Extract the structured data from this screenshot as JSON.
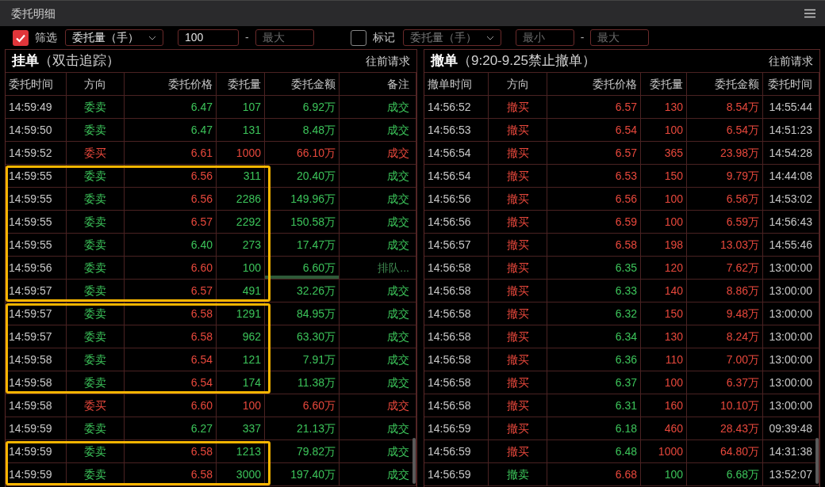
{
  "window": {
    "title": "委托明细"
  },
  "filter": {
    "checked": true,
    "label": "筛选",
    "select": "委托量（手）",
    "min_value": "100",
    "separator": "-",
    "max_placeholder": "最大"
  },
  "mark": {
    "checked": false,
    "label": "标记",
    "select": "委托量（手）",
    "min_placeholder": "最小",
    "separator": "-",
    "max_placeholder": "最大"
  },
  "orders": {
    "title": "挂单",
    "subtitle": "（双击追踪）",
    "action": "往前请求",
    "columns": [
      "委托时间",
      "方向",
      "委托价格",
      "委托量",
      "委托金额",
      "备注"
    ],
    "row_groups": [
      {
        "highlighted": false,
        "rows": [
          {
            "time": "14:59:49",
            "kind": "sell",
            "direction": "委卖",
            "price": "6.47",
            "price_up": false,
            "qty": "107",
            "amount": "6.92万",
            "remark": "成交",
            "queued": false
          },
          {
            "time": "14:59:50",
            "kind": "sell",
            "direction": "委卖",
            "price": "6.47",
            "price_up": false,
            "qty": "131",
            "amount": "8.48万",
            "remark": "成交",
            "queued": false
          },
          {
            "time": "14:59:52",
            "kind": "buy",
            "direction": "委买",
            "price": "6.61",
            "price_up": true,
            "qty": "1000",
            "amount": "66.10万",
            "remark": "成交",
            "queued": false
          }
        ]
      },
      {
        "highlighted": true,
        "rows": [
          {
            "time": "14:59:55",
            "kind": "sell",
            "direction": "委卖",
            "price": "6.56",
            "price_up": true,
            "qty": "311",
            "amount": "20.40万",
            "remark": "成交",
            "queued": false
          },
          {
            "time": "14:59:55",
            "kind": "sell",
            "direction": "委卖",
            "price": "6.56",
            "price_up": true,
            "qty": "2286",
            "amount": "149.96万",
            "remark": "成交",
            "queued": false
          },
          {
            "time": "14:59:55",
            "kind": "sell",
            "direction": "委卖",
            "price": "6.57",
            "price_up": true,
            "qty": "2292",
            "amount": "150.58万",
            "remark": "成交",
            "queued": false
          },
          {
            "time": "14:59:55",
            "kind": "sell",
            "direction": "委卖",
            "price": "6.40",
            "price_up": false,
            "qty": "273",
            "amount": "17.47万",
            "remark": "成交",
            "queued": false
          },
          {
            "time": "14:59:56",
            "kind": "sell",
            "direction": "委卖",
            "price": "6.60",
            "price_up": true,
            "qty": "100",
            "amount": "6.60万",
            "remark": "排队...",
            "queued": true
          },
          {
            "time": "14:59:57",
            "kind": "sell",
            "direction": "委卖",
            "price": "6.57",
            "price_up": true,
            "qty": "491",
            "amount": "32.26万",
            "remark": "成交",
            "queued": false
          }
        ]
      },
      {
        "highlighted": true,
        "rows": [
          {
            "time": "14:59:57",
            "kind": "sell",
            "direction": "委卖",
            "price": "6.58",
            "price_up": true,
            "qty": "1291",
            "amount": "84.95万",
            "remark": "成交",
            "queued": false
          },
          {
            "time": "14:59:57",
            "kind": "sell",
            "direction": "委卖",
            "price": "6.58",
            "price_up": true,
            "qty": "962",
            "amount": "63.30万",
            "remark": "成交",
            "queued": false
          },
          {
            "time": "14:59:58",
            "kind": "sell",
            "direction": "委卖",
            "price": "6.54",
            "price_up": true,
            "qty": "121",
            "amount": "7.91万",
            "remark": "成交",
            "queued": false
          },
          {
            "time": "14:59:58",
            "kind": "sell",
            "direction": "委卖",
            "price": "6.54",
            "price_up": true,
            "qty": "174",
            "amount": "11.38万",
            "remark": "成交",
            "queued": false
          }
        ]
      },
      {
        "highlighted": false,
        "rows": [
          {
            "time": "14:59:58",
            "kind": "buy",
            "direction": "委买",
            "price": "6.60",
            "price_up": true,
            "qty": "100",
            "amount": "6.60万",
            "remark": "成交",
            "queued": false
          },
          {
            "time": "14:59:59",
            "kind": "sell",
            "direction": "委卖",
            "price": "6.27",
            "price_up": false,
            "qty": "337",
            "amount": "21.13万",
            "remark": "成交",
            "queued": false
          }
        ]
      },
      {
        "highlighted": true,
        "rows": [
          {
            "time": "14:59:59",
            "kind": "sell",
            "direction": "委卖",
            "price": "6.58",
            "price_up": true,
            "qty": "1213",
            "amount": "79.82万",
            "remark": "成交",
            "queued": false
          },
          {
            "time": "14:59:59",
            "kind": "sell",
            "direction": "委卖",
            "price": "6.58",
            "price_up": true,
            "qty": "3000",
            "amount": "197.40万",
            "remark": "成交",
            "queued": false
          }
        ]
      }
    ]
  },
  "cancels": {
    "title": "撤单",
    "subtitle": "（9:20-9.25禁止撤单）",
    "action": "往前请求",
    "columns": [
      "撤单时间",
      "方向",
      "委托价格",
      "委托量",
      "委托金额",
      "委托时间"
    ],
    "rows": [
      {
        "time": "14:56:52",
        "kind": "buy",
        "direction": "撤买",
        "price": "6.57",
        "price_up": true,
        "qty": "130",
        "amount": "8.54万",
        "order_time": "14:55:44"
      },
      {
        "time": "14:56:53",
        "kind": "buy",
        "direction": "撤买",
        "price": "6.54",
        "price_up": true,
        "qty": "100",
        "amount": "6.54万",
        "order_time": "14:51:23"
      },
      {
        "time": "14:56:54",
        "kind": "buy",
        "direction": "撤买",
        "price": "6.57",
        "price_up": true,
        "qty": "365",
        "amount": "23.98万",
        "order_time": "14:54:28"
      },
      {
        "time": "14:56:54",
        "kind": "buy",
        "direction": "撤买",
        "price": "6.53",
        "price_up": true,
        "qty": "150",
        "amount": "9.79万",
        "order_time": "14:44:08"
      },
      {
        "time": "14:56:56",
        "kind": "buy",
        "direction": "撤买",
        "price": "6.56",
        "price_up": true,
        "qty": "100",
        "amount": "6.56万",
        "order_time": "14:53:02"
      },
      {
        "time": "14:56:56",
        "kind": "buy",
        "direction": "撤买",
        "price": "6.59",
        "price_up": true,
        "qty": "100",
        "amount": "6.59万",
        "order_time": "14:56:43"
      },
      {
        "time": "14:56:57",
        "kind": "buy",
        "direction": "撤买",
        "price": "6.58",
        "price_up": true,
        "qty": "198",
        "amount": "13.03万",
        "order_time": "14:55:46"
      },
      {
        "time": "14:56:58",
        "kind": "buy",
        "direction": "撤买",
        "price": "6.35",
        "price_up": false,
        "qty": "120",
        "amount": "7.62万",
        "order_time": "13:00:00"
      },
      {
        "time": "14:56:58",
        "kind": "buy",
        "direction": "撤买",
        "price": "6.33",
        "price_up": false,
        "qty": "140",
        "amount": "8.86万",
        "order_time": "13:00:00"
      },
      {
        "time": "14:56:58",
        "kind": "buy",
        "direction": "撤买",
        "price": "6.32",
        "price_up": false,
        "qty": "150",
        "amount": "9.48万",
        "order_time": "13:00:00"
      },
      {
        "time": "14:56:58",
        "kind": "buy",
        "direction": "撤买",
        "price": "6.34",
        "price_up": false,
        "qty": "130",
        "amount": "8.24万",
        "order_time": "13:00:00"
      },
      {
        "time": "14:56:58",
        "kind": "buy",
        "direction": "撤买",
        "price": "6.36",
        "price_up": false,
        "qty": "110",
        "amount": "7.00万",
        "order_time": "13:00:00"
      },
      {
        "time": "14:56:58",
        "kind": "buy",
        "direction": "撤买",
        "price": "6.37",
        "price_up": false,
        "qty": "100",
        "amount": "6.37万",
        "order_time": "13:00:00"
      },
      {
        "time": "14:56:58",
        "kind": "buy",
        "direction": "撤买",
        "price": "6.31",
        "price_up": false,
        "qty": "160",
        "amount": "10.10万",
        "order_time": "13:00:00"
      },
      {
        "time": "14:56:59",
        "kind": "buy",
        "direction": "撤买",
        "price": "6.18",
        "price_up": false,
        "qty": "460",
        "amount": "28.43万",
        "order_time": "09:39:48"
      },
      {
        "time": "14:56:59",
        "kind": "buy",
        "direction": "撤买",
        "price": "6.48",
        "price_up": false,
        "qty": "1000",
        "amount": "64.80万",
        "order_time": "14:31:38"
      },
      {
        "time": "14:56:59",
        "kind": "sell",
        "direction": "撤卖",
        "price": "6.68",
        "price_up": true,
        "qty": "100",
        "amount": "6.68万",
        "order_time": "13:52:07"
      }
    ]
  }
}
